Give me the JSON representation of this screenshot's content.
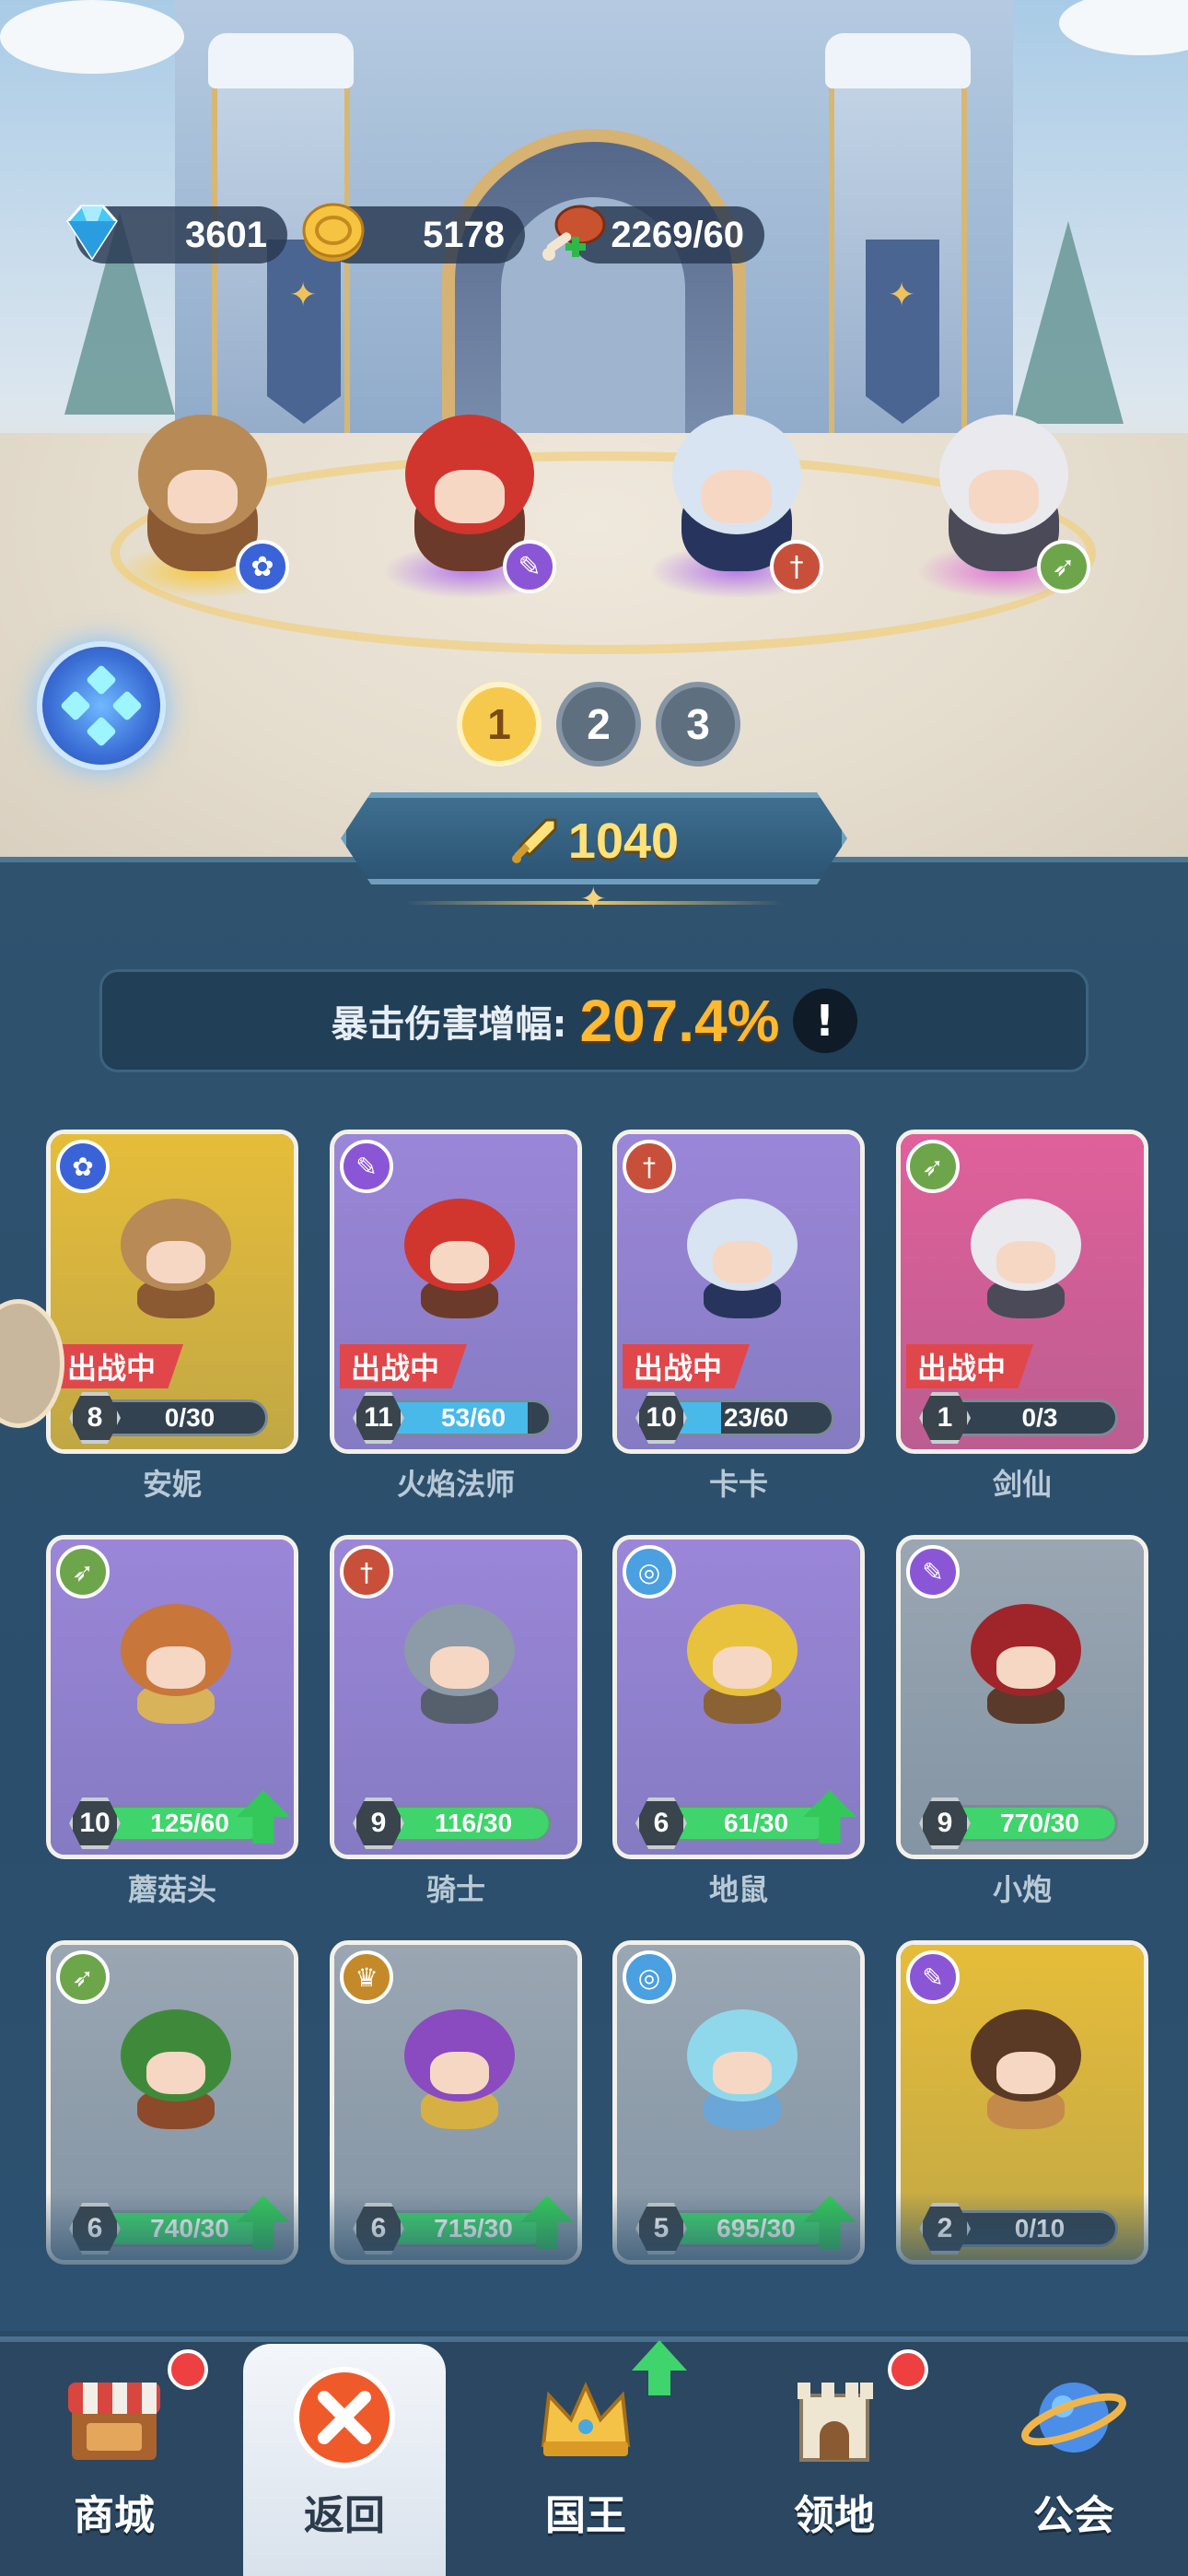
{
  "resources": {
    "gems": "3601",
    "gold": "5178",
    "stamina": "2269/60"
  },
  "field_heroes": [
    {
      "name": "安妮",
      "class_icon": "paw-icon",
      "class_color": "#3b63d8",
      "head_color": "#b88a55",
      "body_color": "#8b5a33",
      "glow": "#f5c842"
    },
    {
      "name": "火焰法师",
      "class_icon": "magic-wand-icon",
      "class_color": "#8b56d6",
      "head_color": "#d0362e",
      "body_color": "#6b3a2a",
      "glow": "#b77be8"
    },
    {
      "name": "卡卡",
      "class_icon": "dagger-icon",
      "class_color": "#c8503a",
      "head_color": "#d8e4f2",
      "body_color": "#27355e",
      "glow": "#b77be8"
    },
    {
      "name": "剑仙",
      "class_icon": "bow-icon",
      "class_color": "#6da64a",
      "head_color": "#e9e9ee",
      "body_color": "#4a4a58",
      "glow": "#e07ad8"
    }
  ],
  "pages": [
    "1",
    "2",
    "3"
  ],
  "active_page": "1",
  "power": "1040",
  "crit": {
    "label": "暴击伤害增幅:",
    "value": "207.4%",
    "info": "!"
  },
  "deployed_label": "出战中",
  "cards": [
    {
      "name": "安妮",
      "level": "8",
      "progress": "0/30",
      "ratio": 0.0,
      "bg": "#e6bd3a",
      "class_icon": "paw-icon",
      "class_color": "#3b63d8",
      "head": "#b88a55",
      "body": "#8b5a33",
      "deployed": true,
      "upgrade": false,
      "bar": "blue"
    },
    {
      "name": "火焰法师",
      "level": "11",
      "progress": "53/60",
      "ratio": 0.88,
      "bg": "#9b86d8",
      "class_icon": "magic-wand-icon",
      "class_color": "#8b56d6",
      "head": "#d0362e",
      "body": "#6b3a2a",
      "deployed": true,
      "upgrade": false,
      "bar": "blue"
    },
    {
      "name": "卡卡",
      "level": "10",
      "progress": "23/60",
      "ratio": 0.38,
      "bg": "#9b86d8",
      "class_icon": "dagger-icon",
      "class_color": "#c8503a",
      "head": "#d8e4f2",
      "body": "#27355e",
      "deployed": true,
      "upgrade": false,
      "bar": "blue"
    },
    {
      "name": "剑仙",
      "level": "1",
      "progress": "0/3",
      "ratio": 0.0,
      "bg": "#e0609a",
      "class_icon": "bow-icon",
      "class_color": "#6da64a",
      "head": "#e9e9ee",
      "body": "#4a4a58",
      "deployed": true,
      "upgrade": false,
      "bar": "blue"
    },
    {
      "name": "蘑菇头",
      "level": "10",
      "progress": "125/60",
      "ratio": 1.0,
      "bg": "#9b86d8",
      "class_icon": "bow-icon",
      "class_color": "#6da64a",
      "head": "#c9763a",
      "body": "#d9b35a",
      "deployed": false,
      "upgrade": true,
      "bar": "green"
    },
    {
      "name": "骑士",
      "level": "9",
      "progress": "116/30",
      "ratio": 1.0,
      "bg": "#9b86d8",
      "class_icon": "dagger-icon",
      "class_color": "#c8503a",
      "head": "#8d9aa8",
      "body": "#56606c",
      "deployed": false,
      "upgrade": false,
      "bar": "green"
    },
    {
      "name": "地鼠",
      "level": "6",
      "progress": "61/30",
      "ratio": 1.0,
      "bg": "#9b86d8",
      "class_icon": "swirl-icon",
      "class_color": "#4aa0e0",
      "head": "#e8c23c",
      "body": "#8a6234",
      "deployed": false,
      "upgrade": true,
      "bar": "green"
    },
    {
      "name": "小炮",
      "level": "9",
      "progress": "770/30",
      "ratio": 1.0,
      "bg": "#9aa6b2",
      "class_icon": "magic-wand-icon",
      "class_color": "#8b56d6",
      "head": "#a0252a",
      "body": "#5a3a2a",
      "deployed": false,
      "upgrade": false,
      "bar": "green"
    },
    {
      "name": "",
      "level": "6",
      "progress": "740/30",
      "ratio": 1.0,
      "bg": "#9aa6b2",
      "class_icon": "bow-icon",
      "class_color": "#6da64a",
      "head": "#3f8a3a",
      "body": "#8c4a2a",
      "deployed": false,
      "upgrade": true,
      "bar": "green"
    },
    {
      "name": "",
      "level": "6",
      "progress": "715/30",
      "ratio": 1.0,
      "bg": "#9aa6b2",
      "class_icon": "wings-icon",
      "class_color": "#c48a2a",
      "head": "#8a4ac0",
      "body": "#d6b042",
      "deployed": false,
      "upgrade": true,
      "bar": "green"
    },
    {
      "name": "",
      "level": "5",
      "progress": "695/30",
      "ratio": 1.0,
      "bg": "#9aa6b2",
      "class_icon": "swirl-icon",
      "class_color": "#4aa0e0",
      "head": "#8fd8ec",
      "body": "#6aa6d8",
      "deployed": false,
      "upgrade": true,
      "bar": "green"
    },
    {
      "name": "",
      "level": "2",
      "progress": "0/10",
      "ratio": 0.0,
      "bg": "#e6bd3a",
      "class_icon": "magic-wand-icon",
      "class_color": "#8b56d6",
      "head": "#5a3a24",
      "body": "#c48a4a",
      "deployed": false,
      "upgrade": false,
      "bar": "blue"
    }
  ],
  "nav": [
    {
      "label": "商城",
      "icon": "shop-icon",
      "badge": "dot"
    },
    {
      "label": "返回",
      "icon": "close-icon",
      "badge": ""
    },
    {
      "label": "国王",
      "icon": "crown-icon",
      "badge": "up"
    },
    {
      "label": "领地",
      "icon": "castle-icon",
      "badge": "dot"
    },
    {
      "label": "公会",
      "icon": "planet-icon",
      "badge": ""
    }
  ]
}
